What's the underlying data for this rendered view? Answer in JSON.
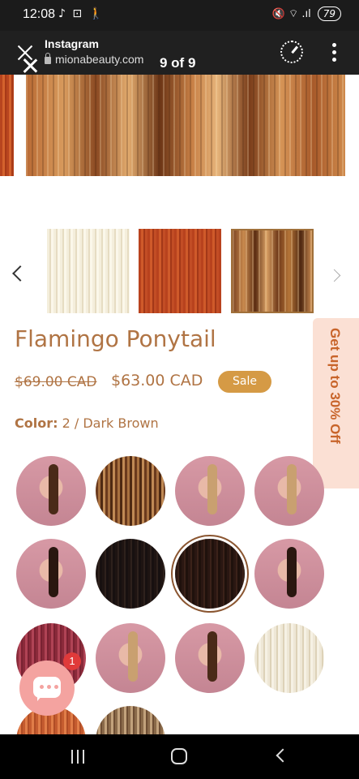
{
  "status_bar": {
    "time": "12:08",
    "left_icons": "♪ ⊡ 🚶",
    "right_icons": "🔇 ⌔ .ıl",
    "battery": "79"
  },
  "browser": {
    "site_name": "Instagram",
    "url": "mionabeauty.com",
    "image_counter": "9 of 9"
  },
  "product": {
    "title": "Flamingo Ponytail",
    "old_price": "$69.00 CAD",
    "new_price": "$63.00 CAD",
    "sale_badge": "Sale",
    "color_label": "Color:",
    "color_value": "2 / Dark Brown"
  },
  "promo": {
    "text": "Get up to 30% Off"
  },
  "chat": {
    "badge_count": "1"
  },
  "swatches": [
    "model-brown-ponytail",
    "brown-highlight-hair",
    "model-blonde-ponytail",
    "model-ash-hair",
    "model-dark-ponytail",
    "black-hair",
    "dark-brown-hair",
    "model-dark-brown-ponytail",
    "burgundy-hair",
    "model-silver-ponytail",
    "model-with-dog",
    "platinum-blonde-hair",
    "copper-hair",
    "mixed-brown-hair"
  ],
  "colors": {
    "accent": "#b07444",
    "sale_badge": "#d59a45",
    "promo_bg": "#fbe0d4",
    "promo_text": "#c8642a",
    "chat_button": "#f4a3a0",
    "notification_badge": "#e03a3a"
  }
}
